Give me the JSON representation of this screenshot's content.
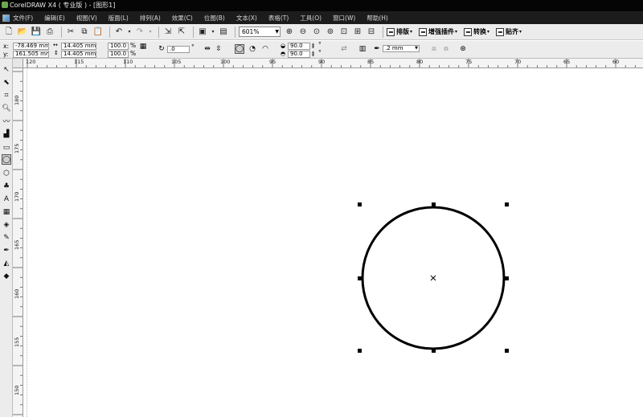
{
  "window": {
    "title": "CorelDRAW X4 ( 专业版 ) - [图形1]"
  },
  "menu": {
    "items": [
      "文件(F)",
      "编辑(E)",
      "视图(V)",
      "版面(L)",
      "排列(A)",
      "效果(C)",
      "位图(B)",
      "文本(X)",
      "表格(T)",
      "工具(O)",
      "窗口(W)",
      "帮助(H)"
    ]
  },
  "toolbar": {
    "zoom_value": "601%",
    "labeled_buttons": [
      "排版",
      "增强插件",
      "转换",
      "贴齐"
    ]
  },
  "property_bar": {
    "x_label": "x:",
    "x_value": "-78.469 mm",
    "y_label": "y:",
    "y_value": "161.505 mm",
    "width_value": "14.405 mm",
    "height_value": "14.405 mm",
    "scale_x": "100.0",
    "scale_y": "100.0",
    "percent": "%",
    "rotation_value": ".0",
    "degree": "°",
    "start_angle": "90.0",
    "end_angle": "90.0",
    "outline_width": ".2 mm"
  },
  "ruler": {
    "top_labels": [
      "120",
      "115",
      "110",
      "105",
      "100",
      "95",
      "90",
      "85",
      "80",
      "75",
      "70",
      "65",
      "60"
    ],
    "left_labels": [
      "180",
      "175",
      "170",
      "165",
      "160",
      "155",
      "150"
    ]
  }
}
